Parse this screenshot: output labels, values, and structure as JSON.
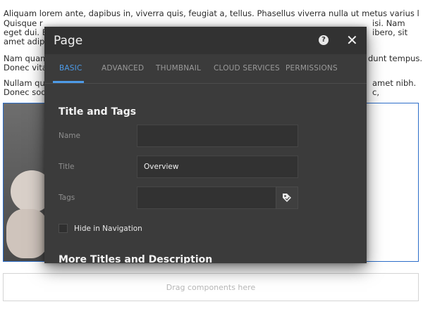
{
  "background": {
    "paragraphs": [
      "Aliquam lorem ante, dapibus in, viverra quis, feugiat a, tellus. Phasellus viverra nulla ut metus varius laoreet.",
      "Quisque r",
      "eget dui. E",
      "amet adipi",
      "Nam quam",
      "Donec vita",
      "Nullam qu",
      "Donec sod"
    ],
    "right_fragments": [
      "isi. Nam",
      "ibero, sit",
      "dunt tempus.",
      "amet nibh.",
      "c,"
    ],
    "drag_placeholder": "Drag components here"
  },
  "dialog": {
    "title": "Page",
    "help_label": "?",
    "close_label": "✕",
    "tabs": [
      {
        "label": "BASIC",
        "active": true
      },
      {
        "label": "ADVANCED",
        "active": false
      },
      {
        "label": "THUMBNAIL",
        "active": false
      },
      {
        "label": "CLOUD SERVICES",
        "active": false
      },
      {
        "label": "PERMISSIONS",
        "active": false
      }
    ],
    "section_title": "Title and Tags",
    "fields": {
      "name": {
        "label": "Name",
        "value": ""
      },
      "title": {
        "label": "Title",
        "value": "Overview"
      },
      "tags": {
        "label": "Tags",
        "value": "",
        "icon": "tag-icon"
      }
    },
    "hide_in_nav": {
      "label": "Hide in Navigation",
      "checked": false
    },
    "next_section_title": "More Titles and Description"
  },
  "colors": {
    "accent": "#4d9be8",
    "dialog_bg": "#3b3b3b",
    "header_bg": "#323232",
    "selection_border": "#2d6ec9"
  }
}
